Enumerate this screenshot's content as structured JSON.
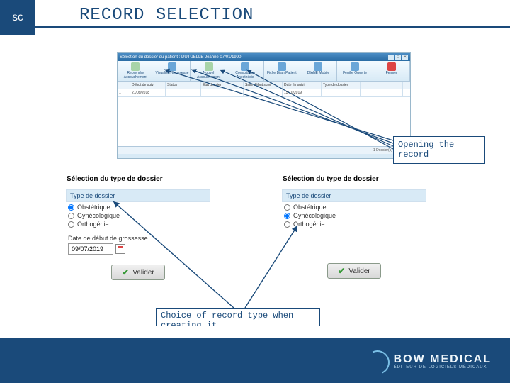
{
  "header": {
    "badge": "SC",
    "title": "RECORD SELECTION"
  },
  "record_window": {
    "title": "Sélection du dossier du patient : DUTUELLE Jeanne  07/01/1990",
    "toolbar": [
      "Reprendre Accouchement",
      "Visualiser Grossesse",
      "Nouvel Accouchement",
      "Consultation Anesthésie",
      "Fiche Bilan Patient",
      "DIANE Mobile",
      "Feuille Ouverte",
      "Fermer"
    ],
    "columns": [
      "",
      "Début de suivi",
      "Status",
      "État dossier",
      "Salle début suivi",
      "Date fin suivi",
      "Type de dossier",
      ""
    ],
    "row": [
      "1",
      "21/09/2018",
      "",
      "",
      "",
      "15/10/2019",
      "",
      ""
    ],
    "footer": "1 Dossier(s) trouvé(s)"
  },
  "annotations": {
    "opening": "Opening the record",
    "choice": "Choice of record type when creating it"
  },
  "dialog_left": {
    "title": "Sélection du type de dossier",
    "group_label": "Type de dossier",
    "options": [
      "Obstétrique",
      "Gynécologique",
      "Orthogénie"
    ],
    "date_label": "Date de début de grossesse",
    "date_value": "09/07/2019",
    "button": "Valider"
  },
  "dialog_right": {
    "title": "Sélection du type de dossier",
    "group_label": "Type de dossier",
    "options": [
      "Obstétrique",
      "Gynécologique",
      "Orthogénie"
    ],
    "button": "Valider"
  },
  "logo": {
    "main": "BOW MEDICAL",
    "sub": "ÉDITEUR DE LOGICIELS MÉDICAUX"
  }
}
